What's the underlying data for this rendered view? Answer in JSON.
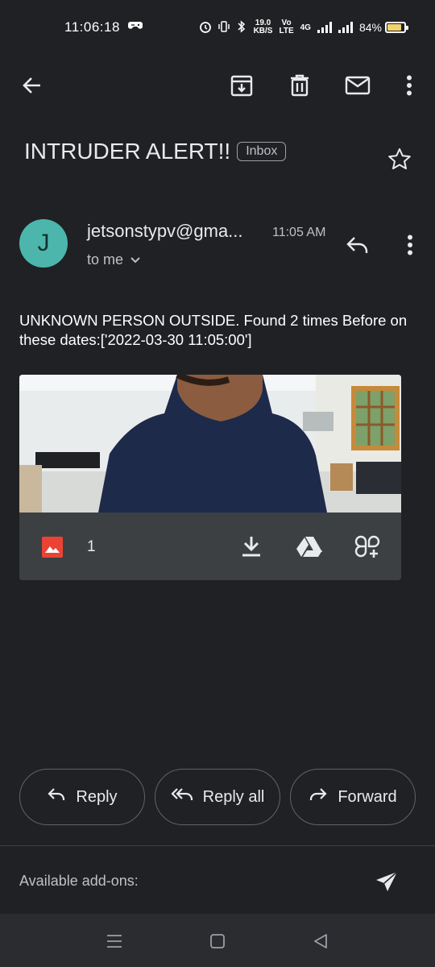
{
  "status_bar": {
    "time": "11:06:18",
    "speed_top": "19.0",
    "speed_bottom": "KB/S",
    "volte_top": "Vo",
    "volte_bottom": "LTE",
    "network": "4G",
    "battery_percent": "84%",
    "battery_level": 0.84
  },
  "toolbar": {
    "icons": [
      "back-arrow-icon",
      "archive-icon",
      "delete-icon",
      "mark-unread-icon",
      "more-vert-icon"
    ]
  },
  "email": {
    "subject": "INTRUDER ALERT!!",
    "label": "Inbox",
    "sender_initial": "J",
    "sender": "jetsonstypv@gma...",
    "time": "11:05 AM",
    "to": "to me",
    "body": "UNKNOWN PERSON OUTSIDE. Found 2 times Before on these dates:['2022-03-30 11:05:00']"
  },
  "attachment": {
    "count": "1"
  },
  "actions": {
    "reply": "Reply",
    "reply_all": "Reply all",
    "forward": "Forward"
  },
  "addons": {
    "label": "Available add-ons:"
  },
  "colors": {
    "background": "#202124",
    "avatar": "#4db6ac",
    "image_icon": "#ea4335"
  }
}
